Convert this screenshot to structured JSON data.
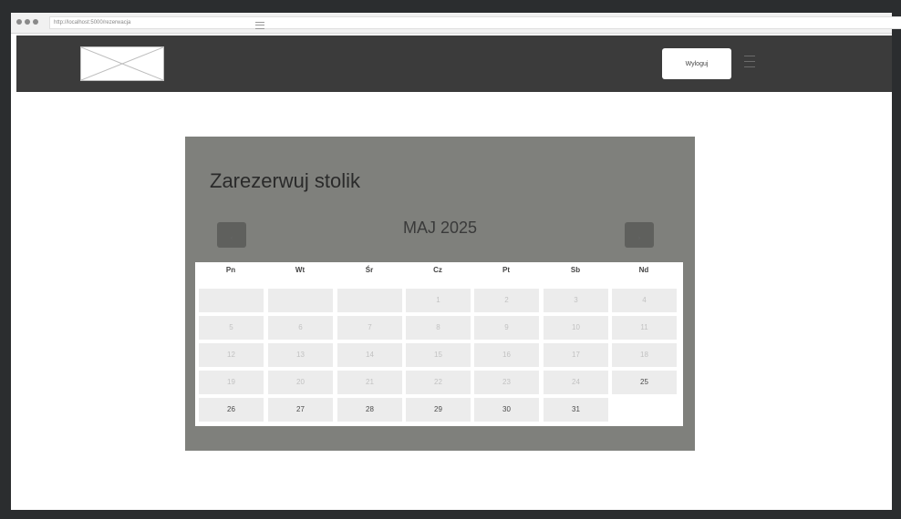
{
  "browser": {
    "url": "http://localhost:5000/rezerwacja"
  },
  "header": {
    "logout_label": "Wyloguj"
  },
  "main": {
    "title": "Zarezerwuj stolik",
    "month_label": "MAJ 2025",
    "prev_label": "‹",
    "next_label": "›"
  },
  "calendar": {
    "weekdays": [
      "Pn",
      "Wt",
      "Śr",
      "Cz",
      "Pt",
      "Sb",
      "Nd"
    ],
    "weeks": [
      [
        {
          "d": "",
          "s": "blank"
        },
        {
          "d": "",
          "s": "blank"
        },
        {
          "d": "",
          "s": "blank"
        },
        {
          "d": "1",
          "s": "disabled"
        },
        {
          "d": "2",
          "s": "disabled"
        },
        {
          "d": "3",
          "s": "disabled"
        },
        {
          "d": "4",
          "s": "disabled"
        }
      ],
      [
        {
          "d": "5",
          "s": "disabled"
        },
        {
          "d": "6",
          "s": "disabled"
        },
        {
          "d": "7",
          "s": "disabled"
        },
        {
          "d": "8",
          "s": "disabled"
        },
        {
          "d": "9",
          "s": "disabled"
        },
        {
          "d": "10",
          "s": "disabled"
        },
        {
          "d": "11",
          "s": "disabled"
        }
      ],
      [
        {
          "d": "12",
          "s": "disabled"
        },
        {
          "d": "13",
          "s": "disabled"
        },
        {
          "d": "14",
          "s": "disabled"
        },
        {
          "d": "15",
          "s": "disabled"
        },
        {
          "d": "16",
          "s": "disabled"
        },
        {
          "d": "17",
          "s": "disabled"
        },
        {
          "d": "18",
          "s": "disabled"
        }
      ],
      [
        {
          "d": "19",
          "s": "disabled"
        },
        {
          "d": "20",
          "s": "disabled"
        },
        {
          "d": "21",
          "s": "disabled"
        },
        {
          "d": "22",
          "s": "disabled"
        },
        {
          "d": "23",
          "s": "disabled"
        },
        {
          "d": "24",
          "s": "disabled"
        },
        {
          "d": "25",
          "s": "active"
        }
      ],
      [
        {
          "d": "26",
          "s": "active"
        },
        {
          "d": "27",
          "s": "active"
        },
        {
          "d": "28",
          "s": "active"
        },
        {
          "d": "29",
          "s": "active"
        },
        {
          "d": "30",
          "s": "active"
        },
        {
          "d": "31",
          "s": "active"
        }
      ]
    ]
  },
  "colors": {
    "header_bg": "#3b3b3b",
    "card_bg": "#7f807c",
    "page_bg": "#ffffff",
    "frame_bg": "#2b2d2f"
  }
}
